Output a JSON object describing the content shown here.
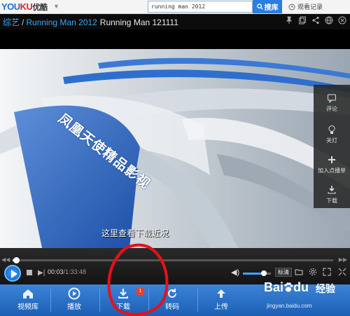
{
  "header": {
    "logo_brand": "YOUKU",
    "logo_cn": "优酷",
    "search_value": "running man 2012",
    "search_button": "搜库",
    "history_label": "观看记录"
  },
  "title_bar": {
    "category": "综艺",
    "separator": "/",
    "show": "Running Man 2012",
    "episode": "Running Man 121111"
  },
  "video": {
    "subtitle": "这里查看下载近况",
    "overlay_text": "凤凰天使精品影视"
  },
  "side_panel": {
    "items": [
      {
        "label": "评论",
        "icon": "comment-icon"
      },
      {
        "label": "关灯",
        "icon": "lightbulb-icon"
      },
      {
        "label": "加入点播单",
        "icon": "plus-icon"
      },
      {
        "label": "下载",
        "icon": "download-icon"
      }
    ]
  },
  "player": {
    "current_time": "00:03",
    "total_time": "/1:33:48",
    "quality": "标清",
    "progress": 0.01,
    "volume": 0.75
  },
  "bottom_nav": {
    "items": [
      {
        "label": "视频库",
        "icon": "home-icon"
      },
      {
        "label": "播放",
        "icon": "play-circle-icon"
      },
      {
        "label": "下载",
        "icon": "download-icon",
        "badge": "1"
      },
      {
        "label": "转码",
        "icon": "refresh-icon"
      },
      {
        "label": "上传",
        "icon": "upload-icon"
      }
    ]
  },
  "watermark": {
    "brand": "Bai",
    "brand_suffix": "du",
    "jingyan": "经验",
    "url": "jingyan.baidu.com"
  },
  "colors": {
    "accent": "#2a7ee0",
    "nav_bg": "#1b5fb4",
    "annotation": "#e8101a"
  }
}
